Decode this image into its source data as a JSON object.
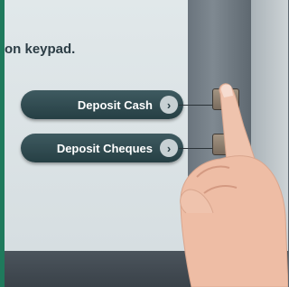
{
  "screen": {
    "prompt_text": "on keypad.",
    "buttons": [
      {
        "label": "Deposit Cash",
        "icon": "chevron-right-icon"
      },
      {
        "label": "Deposit Cheques",
        "icon": "chevron-right-icon"
      }
    ]
  },
  "colors": {
    "button_bg": "#263f44",
    "screen_bg": "#dde5e7",
    "bezel_green": "#1f7a5c"
  }
}
